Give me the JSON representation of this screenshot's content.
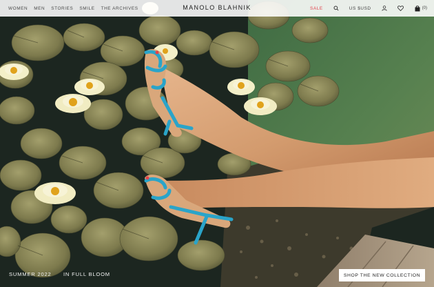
{
  "header": {
    "nav_left": [
      {
        "id": "women",
        "label": "WOMEN"
      },
      {
        "id": "men",
        "label": "MEN"
      },
      {
        "id": "stories",
        "label": "STORIES"
      },
      {
        "id": "smile",
        "label": "SMILE"
      },
      {
        "id": "archives",
        "label": "THE ARCHIVES"
      }
    ],
    "logo": "MANOLO BLAHNIK",
    "sale_label": "SALE",
    "currency_label": "US $USD",
    "bag_count": "(0)",
    "icons": {
      "search": "search-icon",
      "account": "user-icon",
      "wishlist": "heart-icon",
      "bag": "shopping-bag-icon"
    }
  },
  "hero": {
    "season_label": "SUMMER 2022",
    "collection_label": "IN FULL BLOOM",
    "cta_label": "SHOP THE NEW COLLECTION"
  },
  "colors": {
    "sale": "#e2434b",
    "shoe": "#2aa4c9",
    "water": "#1e2a22"
  }
}
